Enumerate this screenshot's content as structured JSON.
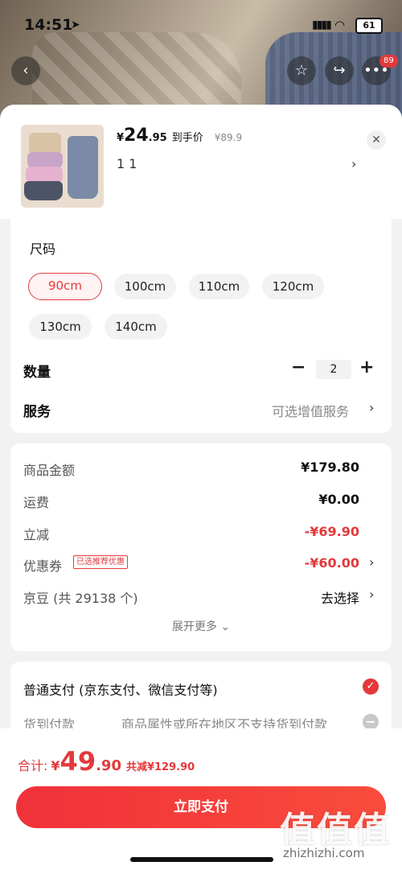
{
  "status_bar": {
    "time": "14:51",
    "battery": "61"
  },
  "top_actions": {
    "badge_count": "89"
  },
  "product": {
    "price_symbol": "¥",
    "price_int": "24",
    "price_dec": ".95",
    "price_tag": "到手价",
    "original_price": "¥89.9",
    "selected_variant": "1 1"
  },
  "size": {
    "label": "尺码",
    "options": [
      "90cm",
      "100cm",
      "110cm",
      "120cm",
      "130cm",
      "140cm"
    ],
    "selected": "90cm"
  },
  "quantity": {
    "label": "数量",
    "value": "2",
    "minus": "−",
    "plus": "+"
  },
  "service": {
    "label": "服务",
    "value": "可选增值服务"
  },
  "summary": {
    "goods_label": "商品金额",
    "goods_value": "¥179.80",
    "shipping_label": "运费",
    "shipping_value": "¥0.00",
    "instant_label": "立减",
    "instant_value": "-¥69.90",
    "coupon_label": "优惠券",
    "coupon_tag": "已选推荐优惠",
    "coupon_value": "-¥60.00",
    "jingdou_label": "京豆 (共 29138 个)",
    "jingdou_value": "去选择",
    "expand": "展开更多"
  },
  "payment": {
    "normal_label": "普通支付 (京东支付、微信支付等)",
    "cod_label": "货到付款",
    "cod_note": "商品属性或所在地区不支持货到付款"
  },
  "footer": {
    "total_label": "合计:",
    "total_symbol": "¥",
    "total_int": "49",
    "total_dec": ".90",
    "saved": "共减¥129.90",
    "pay_button": "立即支付"
  },
  "watermark": {
    "text": "值值值",
    "site": "zhizhizhi.com"
  },
  "colors": {
    "accent": "#e4393c"
  }
}
